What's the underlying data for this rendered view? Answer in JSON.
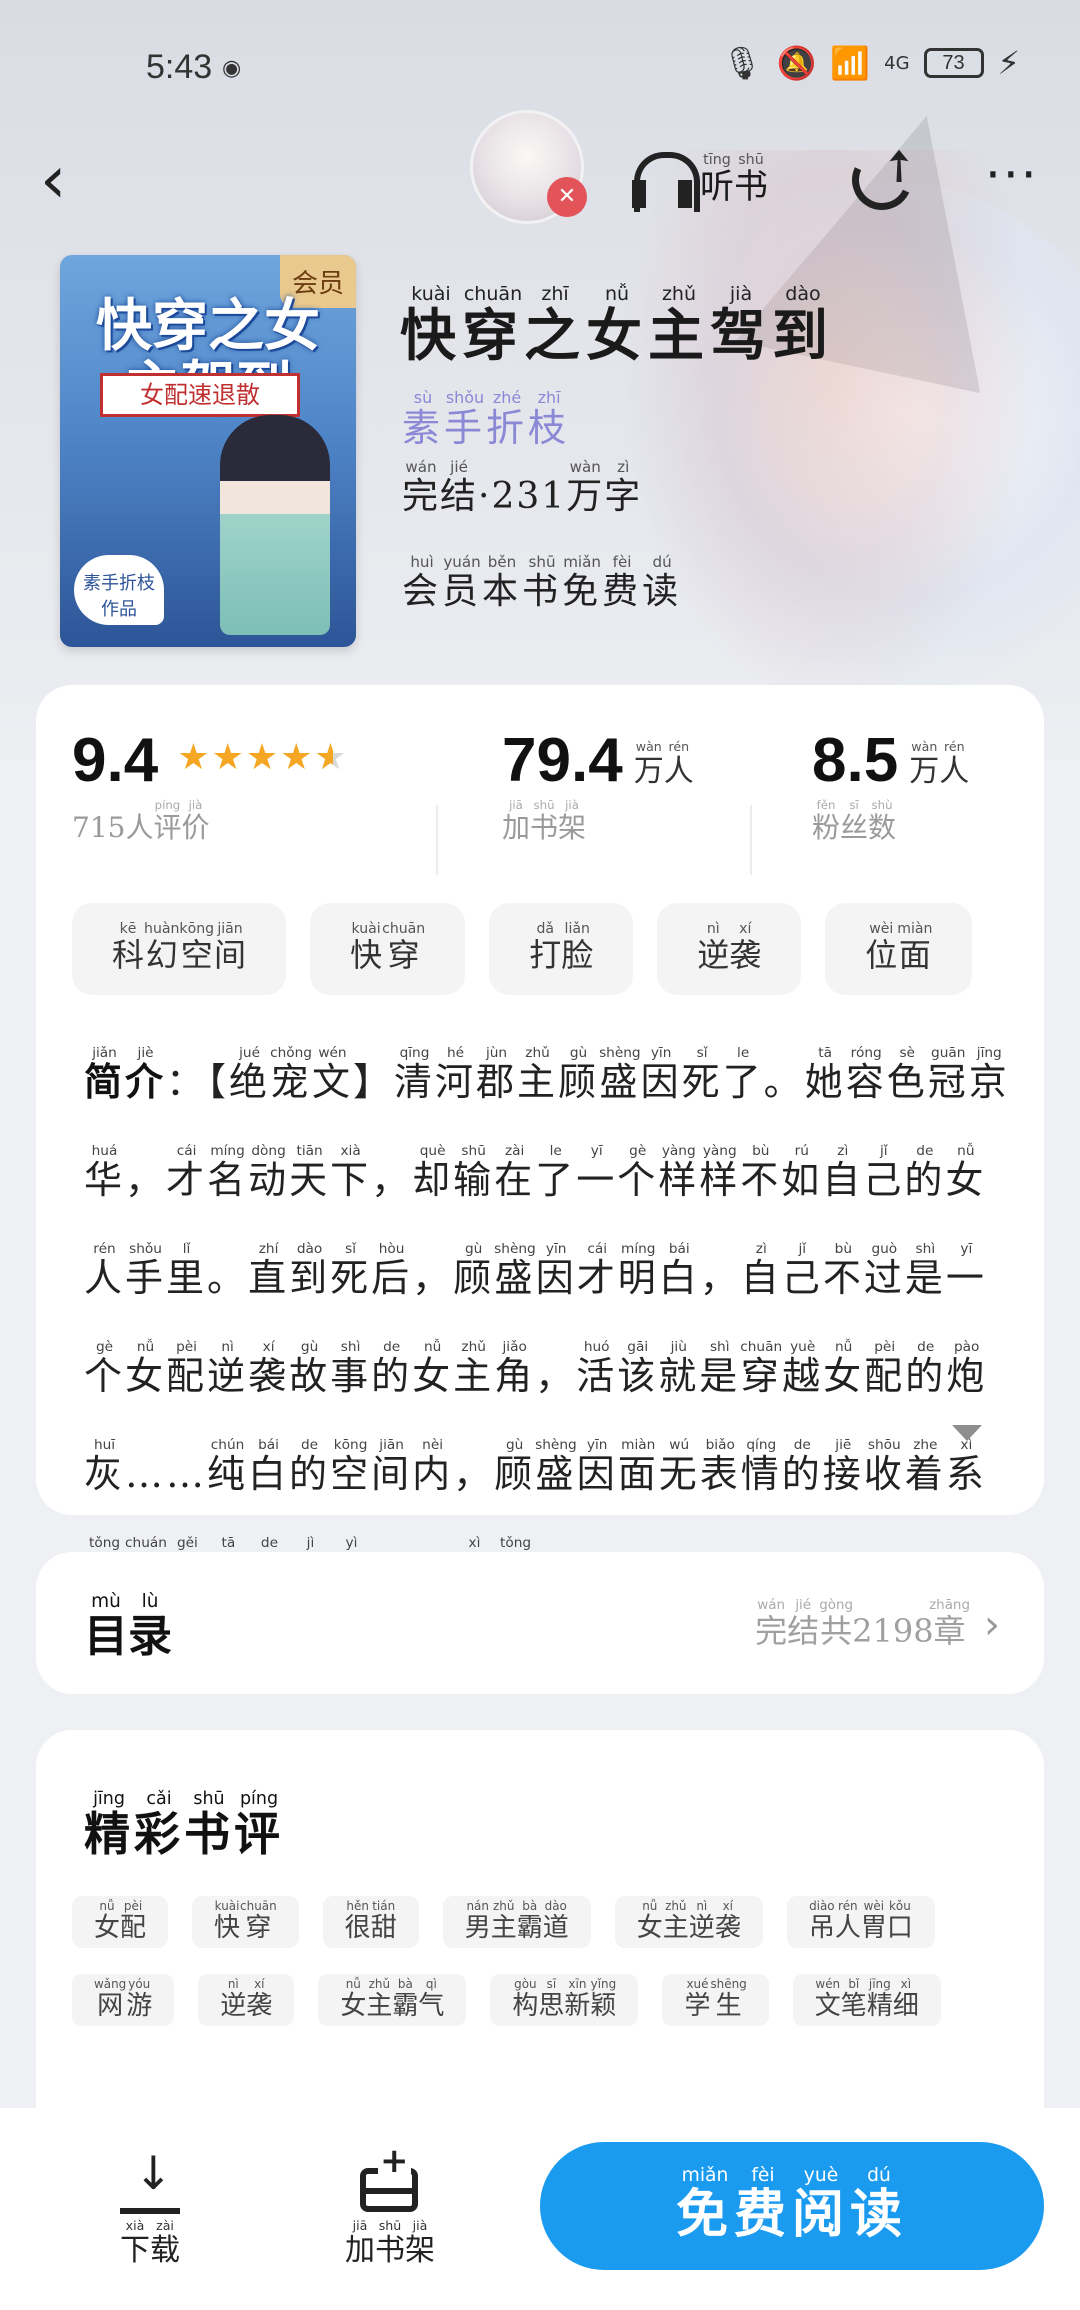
{
  "status_bar": {
    "time": "5:43",
    "network": "4G",
    "battery": "73"
  },
  "nav": {
    "back_icon": "chevron-left-icon",
    "listen": {
      "chars": [
        [
          "听",
          "tīng"
        ],
        [
          "书",
          "shū"
        ]
      ]
    },
    "share_icon": "share-icon",
    "more_icon": "more-icon"
  },
  "book": {
    "cover": {
      "vip_tag": "会员",
      "cover_title": "快穿之女主驾到",
      "cover_subtitle": "女配速退散",
      "cover_author": "素手折枝 作品"
    },
    "title": [
      [
        "快",
        "kuài"
      ],
      [
        "穿",
        "chuān"
      ],
      [
        "之",
        "zhī"
      ],
      [
        "女",
        "nǚ"
      ],
      [
        "主",
        "zhǔ"
      ],
      [
        "驾",
        "jià"
      ],
      [
        "到",
        "dào"
      ]
    ],
    "author": [
      [
        "素",
        "sù"
      ],
      [
        "手",
        "shǒu"
      ],
      [
        "折",
        "zhé"
      ],
      [
        "枝",
        "zhī"
      ]
    ],
    "meta": [
      [
        "完",
        "wán"
      ],
      [
        "结",
        "jié"
      ],
      [
        "·231",
        ""
      ],
      [
        "万",
        "wàn"
      ],
      [
        "字",
        "zì"
      ]
    ],
    "vip_free": [
      [
        "会",
        "huì"
      ],
      [
        "员",
        "yuán"
      ],
      [
        "本",
        "běn"
      ],
      [
        "书",
        "shū"
      ],
      [
        "免",
        "miǎn"
      ],
      [
        "费",
        "fèi"
      ],
      [
        "读",
        "dú"
      ]
    ]
  },
  "stats": {
    "rating": "9.4",
    "rating_stars": 4.5,
    "rating_label": [
      [
        "715人",
        ""
      ],
      [
        "评",
        "píng"
      ],
      [
        "价",
        "jià"
      ]
    ],
    "shelf_count": "79.4",
    "shelf_unit": [
      [
        "万",
        "wàn"
      ],
      [
        "人",
        "rén"
      ]
    ],
    "shelf_label": [
      [
        "加",
        "jiā"
      ],
      [
        "书",
        "shū"
      ],
      [
        "架",
        "jià"
      ]
    ],
    "fans_count": "8.5",
    "fans_unit": [
      [
        "万",
        "wàn"
      ],
      [
        "人",
        "rén"
      ]
    ],
    "fans_label": [
      [
        "粉",
        "fěn"
      ],
      [
        "丝",
        "sī"
      ],
      [
        "数",
        "shù"
      ]
    ]
  },
  "tags": [
    [
      [
        "科",
        "kē"
      ],
      [
        "幻",
        "huàn"
      ],
      [
        "空",
        "kōng"
      ],
      [
        "间",
        "jiān"
      ]
    ],
    [
      [
        "快",
        "kuài"
      ],
      [
        "穿",
        "chuān"
      ]
    ],
    [
      [
        "打",
        "dǎ"
      ],
      [
        "脸",
        "liǎn"
      ]
    ],
    [
      [
        "逆",
        "nì"
      ],
      [
        "袭",
        "xí"
      ]
    ],
    [
      [
        "位",
        "wèi"
      ],
      [
        "面",
        "miàn"
      ]
    ]
  ],
  "intro": {
    "lead": [
      [
        "简",
        "jiǎn"
      ],
      [
        "介",
        "jiè"
      ]
    ],
    "text": [
      [
        "：【",
        ""
      ],
      [
        "绝",
        "jué"
      ],
      [
        "宠",
        "chǒng"
      ],
      [
        "文",
        "wén"
      ],
      [
        "】",
        ""
      ],
      [
        "清",
        "qīng"
      ],
      [
        "河",
        "hé"
      ],
      [
        "郡",
        "jùn"
      ],
      [
        "主",
        "zhǔ"
      ],
      [
        "顾",
        "gù"
      ],
      [
        "盛",
        "shèng"
      ],
      [
        "因",
        "yīn"
      ],
      [
        "死",
        "sǐ"
      ],
      [
        "了",
        "le"
      ],
      [
        "。",
        ""
      ],
      [
        "她",
        "tā"
      ],
      [
        "容",
        "róng"
      ],
      [
        "色",
        "sè"
      ],
      [
        "冠",
        "guān"
      ],
      [
        "京",
        "jīng"
      ],
      [
        "华",
        "huá"
      ],
      [
        "，",
        ""
      ],
      [
        "才",
        "cái"
      ],
      [
        "名",
        "míng"
      ],
      [
        "动",
        "dòng"
      ],
      [
        "天",
        "tiān"
      ],
      [
        "下",
        "xià"
      ],
      [
        "，",
        ""
      ],
      [
        "却",
        "què"
      ],
      [
        "输",
        "shū"
      ],
      [
        "在",
        "zài"
      ],
      [
        "了",
        "le"
      ],
      [
        "一",
        "yī"
      ],
      [
        "个",
        "gè"
      ],
      [
        "样",
        "yàng"
      ],
      [
        "样",
        "yàng"
      ],
      [
        "不",
        "bù"
      ],
      [
        "如",
        "rú"
      ],
      [
        "自",
        "zì"
      ],
      [
        "己",
        "jǐ"
      ],
      [
        "的",
        "de"
      ],
      [
        "女",
        "nǚ"
      ],
      [
        "人",
        "rén"
      ],
      [
        "手",
        "shǒu"
      ],
      [
        "里",
        "lǐ"
      ],
      [
        "。",
        ""
      ],
      [
        "直",
        "zhí"
      ],
      [
        "到",
        "dào"
      ],
      [
        "死",
        "sǐ"
      ],
      [
        "后",
        "hòu"
      ],
      [
        "，",
        ""
      ],
      [
        "顾",
        "gù"
      ],
      [
        "盛",
        "shèng"
      ],
      [
        "因",
        "yīn"
      ],
      [
        "才",
        "cái"
      ],
      [
        "明",
        "míng"
      ],
      [
        "白",
        "bái"
      ],
      [
        "，",
        ""
      ],
      [
        "自",
        "zì"
      ],
      [
        "己",
        "jǐ"
      ],
      [
        "不",
        "bù"
      ],
      [
        "过",
        "guò"
      ],
      [
        "是",
        "shì"
      ],
      [
        "一",
        "yī"
      ],
      [
        "个",
        "gè"
      ],
      [
        "女",
        "nǚ"
      ],
      [
        "配",
        "pèi"
      ],
      [
        "逆",
        "nì"
      ],
      [
        "袭",
        "xí"
      ],
      [
        "故",
        "gù"
      ],
      [
        "事",
        "shì"
      ],
      [
        "的",
        "de"
      ],
      [
        "女",
        "nǚ"
      ],
      [
        "主",
        "zhǔ"
      ],
      [
        "角",
        "jiǎo"
      ],
      [
        "，",
        ""
      ],
      [
        "活",
        "huó"
      ],
      [
        "该",
        "gāi"
      ],
      [
        "就",
        "jiù"
      ],
      [
        "是",
        "shì"
      ],
      [
        "穿",
        "chuān"
      ],
      [
        "越",
        "yuè"
      ],
      [
        "女",
        "nǚ"
      ],
      [
        "配",
        "pèi"
      ],
      [
        "的",
        "de"
      ],
      [
        "炮",
        "pào"
      ],
      [
        "灰",
        "huī"
      ],
      [
        "……",
        ""
      ],
      [
        "纯",
        "chún"
      ],
      [
        "白",
        "bái"
      ],
      [
        "的",
        "de"
      ],
      [
        "空",
        "kōng"
      ],
      [
        "间",
        "jiān"
      ],
      [
        "内",
        "nèi"
      ],
      [
        "，",
        ""
      ],
      [
        "顾",
        "gù"
      ],
      [
        "盛",
        "shèng"
      ],
      [
        "因",
        "yīn"
      ],
      [
        "面",
        "miàn"
      ],
      [
        "无",
        "wú"
      ],
      [
        "表",
        "biǎo"
      ],
      [
        "情",
        "qíng"
      ],
      [
        "的",
        "de"
      ],
      [
        "接",
        "jiē"
      ],
      [
        "收",
        "shōu"
      ],
      [
        "着",
        "zhe"
      ],
      [
        "系",
        "xì"
      ],
      [
        "统",
        "tǒng"
      ],
      [
        "传",
        "chuán"
      ],
      [
        "给",
        "gěi"
      ],
      [
        "她",
        "tā"
      ],
      [
        "的",
        "de"
      ],
      [
        "记",
        "jì"
      ],
      [
        "忆",
        "yì"
      ],
      [
        "……",
        ""
      ],
      [
        "系",
        "xì"
      ],
      [
        "统",
        "tǒng"
      ],
      [
        "：“…",
        ""
      ]
    ],
    "expand_icon": "triangle-down-icon"
  },
  "toc": {
    "title": [
      [
        "目",
        "mù"
      ],
      [
        "录",
        "lù"
      ]
    ],
    "info": [
      [
        "完",
        "wán"
      ],
      [
        "结",
        "jié"
      ],
      [
        "共",
        "gòng"
      ],
      [
        "2198",
        ""
      ],
      [
        "章",
        "zhāng"
      ]
    ]
  },
  "reviews": {
    "title": [
      [
        "精",
        "jīng"
      ],
      [
        "彩",
        "cǎi"
      ],
      [
        "书",
        "shū"
      ],
      [
        "评",
        "píng"
      ]
    ],
    "tags": [
      [
        [
          "女",
          "nǚ"
        ],
        [
          "配",
          "pèi"
        ]
      ],
      [
        [
          "快",
          "kuài"
        ],
        [
          "穿",
          "chuān"
        ]
      ],
      [
        [
          "很",
          "hěn"
        ],
        [
          "甜",
          "tián"
        ]
      ],
      [
        [
          "男",
          "nán"
        ],
        [
          "主",
          "zhǔ"
        ],
        [
          "霸",
          "bà"
        ],
        [
          "道",
          "dào"
        ]
      ],
      [
        [
          "女",
          "nǚ"
        ],
        [
          "主",
          "zhǔ"
        ],
        [
          "逆",
          "nì"
        ],
        [
          "袭",
          "xí"
        ]
      ],
      [
        [
          "吊",
          "diào"
        ],
        [
          "人",
          "rén"
        ],
        [
          "胃",
          "wèi"
        ],
        [
          "口",
          "kǒu"
        ]
      ],
      [
        [
          "网",
          "wǎng"
        ],
        [
          "游",
          "yóu"
        ]
      ],
      [
        [
          "逆",
          "nì"
        ],
        [
          "袭",
          "xí"
        ]
      ],
      [
        [
          "女",
          "nǚ"
        ],
        [
          "主",
          "zhǔ"
        ],
        [
          "霸",
          "bà"
        ],
        [
          "气",
          "qì"
        ]
      ],
      [
        [
          "构",
          "gòu"
        ],
        [
          "思",
          "sī"
        ],
        [
          "新",
          "xīn"
        ],
        [
          "颖",
          "yǐng"
        ]
      ],
      [
        [
          "学",
          "xué"
        ],
        [
          "生",
          "shēng"
        ]
      ],
      [
        [
          "文",
          "wén"
        ],
        [
          "笔",
          "bǐ"
        ],
        [
          "精",
          "jīng"
        ],
        [
          "细",
          "xì"
        ]
      ]
    ]
  },
  "bottom_bar": {
    "download": [
      [
        "下",
        "xià"
      ],
      [
        "载",
        "zài"
      ]
    ],
    "add_shelf": [
      [
        "加",
        "jiā"
      ],
      [
        "书",
        "shū"
      ],
      [
        "架",
        "jià"
      ]
    ],
    "read_free": [
      [
        "免",
        "miǎn"
      ],
      [
        "费",
        "fèi"
      ],
      [
        "阅",
        "yuè"
      ],
      [
        "读",
        "dú"
      ]
    ]
  },
  "colors": {
    "accent": "#1a9bf0",
    "author": "#8b88d6",
    "star": "#f5a623",
    "vip_tag": "#e9c98d"
  }
}
